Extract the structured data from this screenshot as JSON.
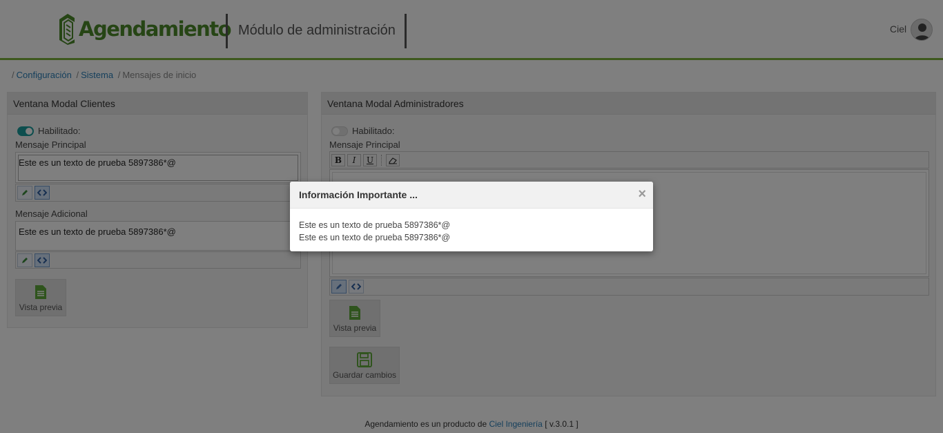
{
  "header": {
    "logo_text": "Agendamiento",
    "module_title": "Módulo de administración",
    "user_name": "Ciel",
    "accent_color": "#7ab03a"
  },
  "breadcrumb": {
    "items": [
      "Configuración",
      "Sistema",
      "Mensajes de inicio"
    ]
  },
  "panel_clients": {
    "title": "Ventana Modal Clientes",
    "enabled_label": "Habilitado:",
    "enabled": true,
    "main_label": "Mensaje Principal",
    "main_text": "Este es un texto de prueba 5897386*@",
    "additional_label": "Mensaje Adicional",
    "additional_text": "Este es un texto de prueba 5897386*@",
    "preview_label": "Vista previa"
  },
  "panel_admins": {
    "title": "Ventana Modal Administradores",
    "enabled_label": "Habilitado:",
    "enabled": false,
    "main_label": "Mensaje Principal",
    "bold_label": "B",
    "italic_label": "I",
    "underline_label": "U",
    "preview_label": "Vista previa",
    "save_label": "Guardar cambios"
  },
  "modal": {
    "title": "Información Importante ...",
    "close_symbol": "×",
    "line1": "Este es un texto de prueba 5897386*@",
    "line2": "Este es un texto de prueba 5897386*@"
  },
  "footer": {
    "prefix": "Agendamiento es un producto de",
    "company": "Ciel Ingeniería",
    "version": "[ v.3.0.1 ]"
  }
}
